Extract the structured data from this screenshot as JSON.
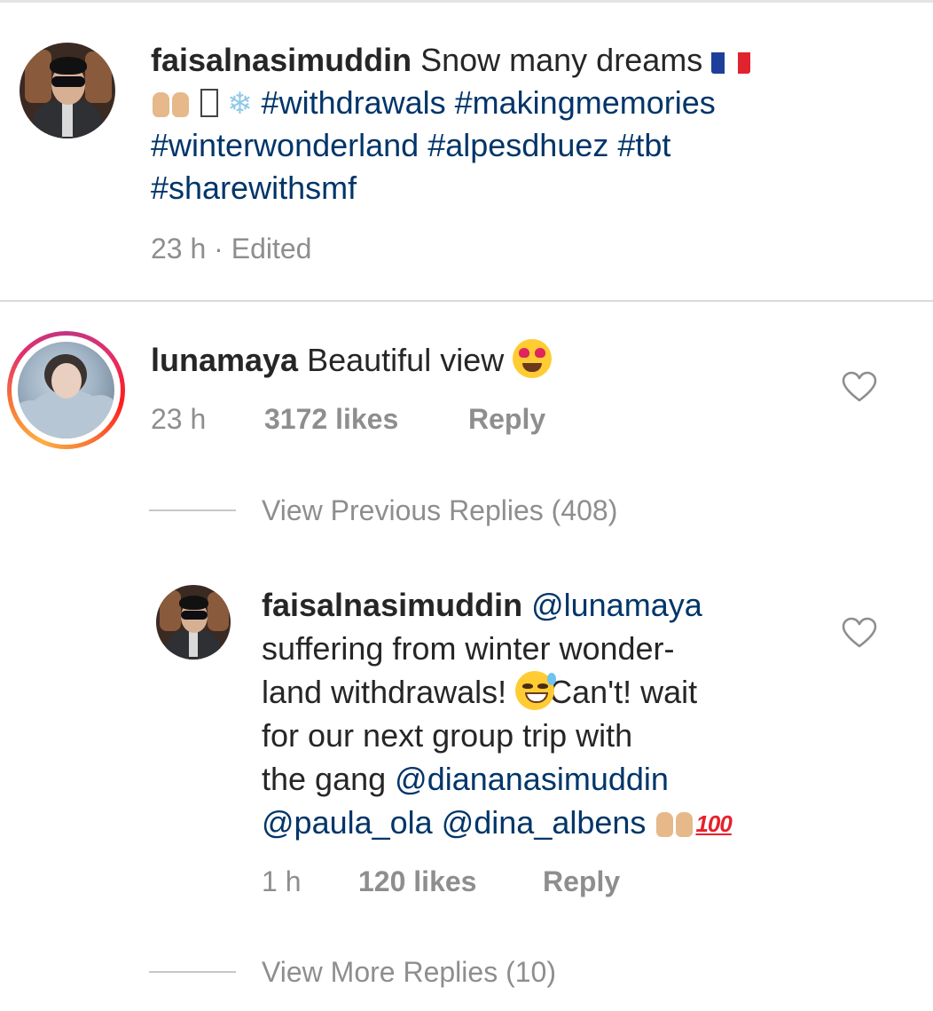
{
  "post": {
    "username": "faisalnasimuddin",
    "caption_text": "Snow many dreams",
    "caption_emoji_flag": "🇫🇷",
    "caption_emoji_hands": "🙌🏼",
    "caption_emoji_snow": "❄️",
    "hashtags_line1": "#withdrawals #makingmemories",
    "hashtags_line2": "#winterwonderland #alpesdhuez #tbt",
    "hashtags_line3": "#sharewithsmf",
    "meta": "23 h · Edited"
  },
  "comment": {
    "username": "lunamaya",
    "text": "Beautiful view",
    "emoji": "😍",
    "time": "23 h",
    "likes": "3172 likes",
    "reply_label": "Reply",
    "view_previous": "View Previous Replies (408)"
  },
  "reply": {
    "username": "faisalnasimuddin",
    "mention1": "@lunamaya",
    "line2": "suffering from winter wonder-",
    "line3_a": "land withdrawals!",
    "line3_emoji": "😅",
    "line3_b": "Can't! wait",
    "line4": "for our next group trip with",
    "line5_a": "the gang",
    "mention2": "@diananasimuddin",
    "mention3": "@paula_ola",
    "mention4": "@dina_albens",
    "emoji_hands": "🙌🏼",
    "emoji_100": "💯",
    "time": "1 h",
    "likes": "120 likes",
    "reply_label": "Reply",
    "view_more": "View More Replies (10)"
  }
}
